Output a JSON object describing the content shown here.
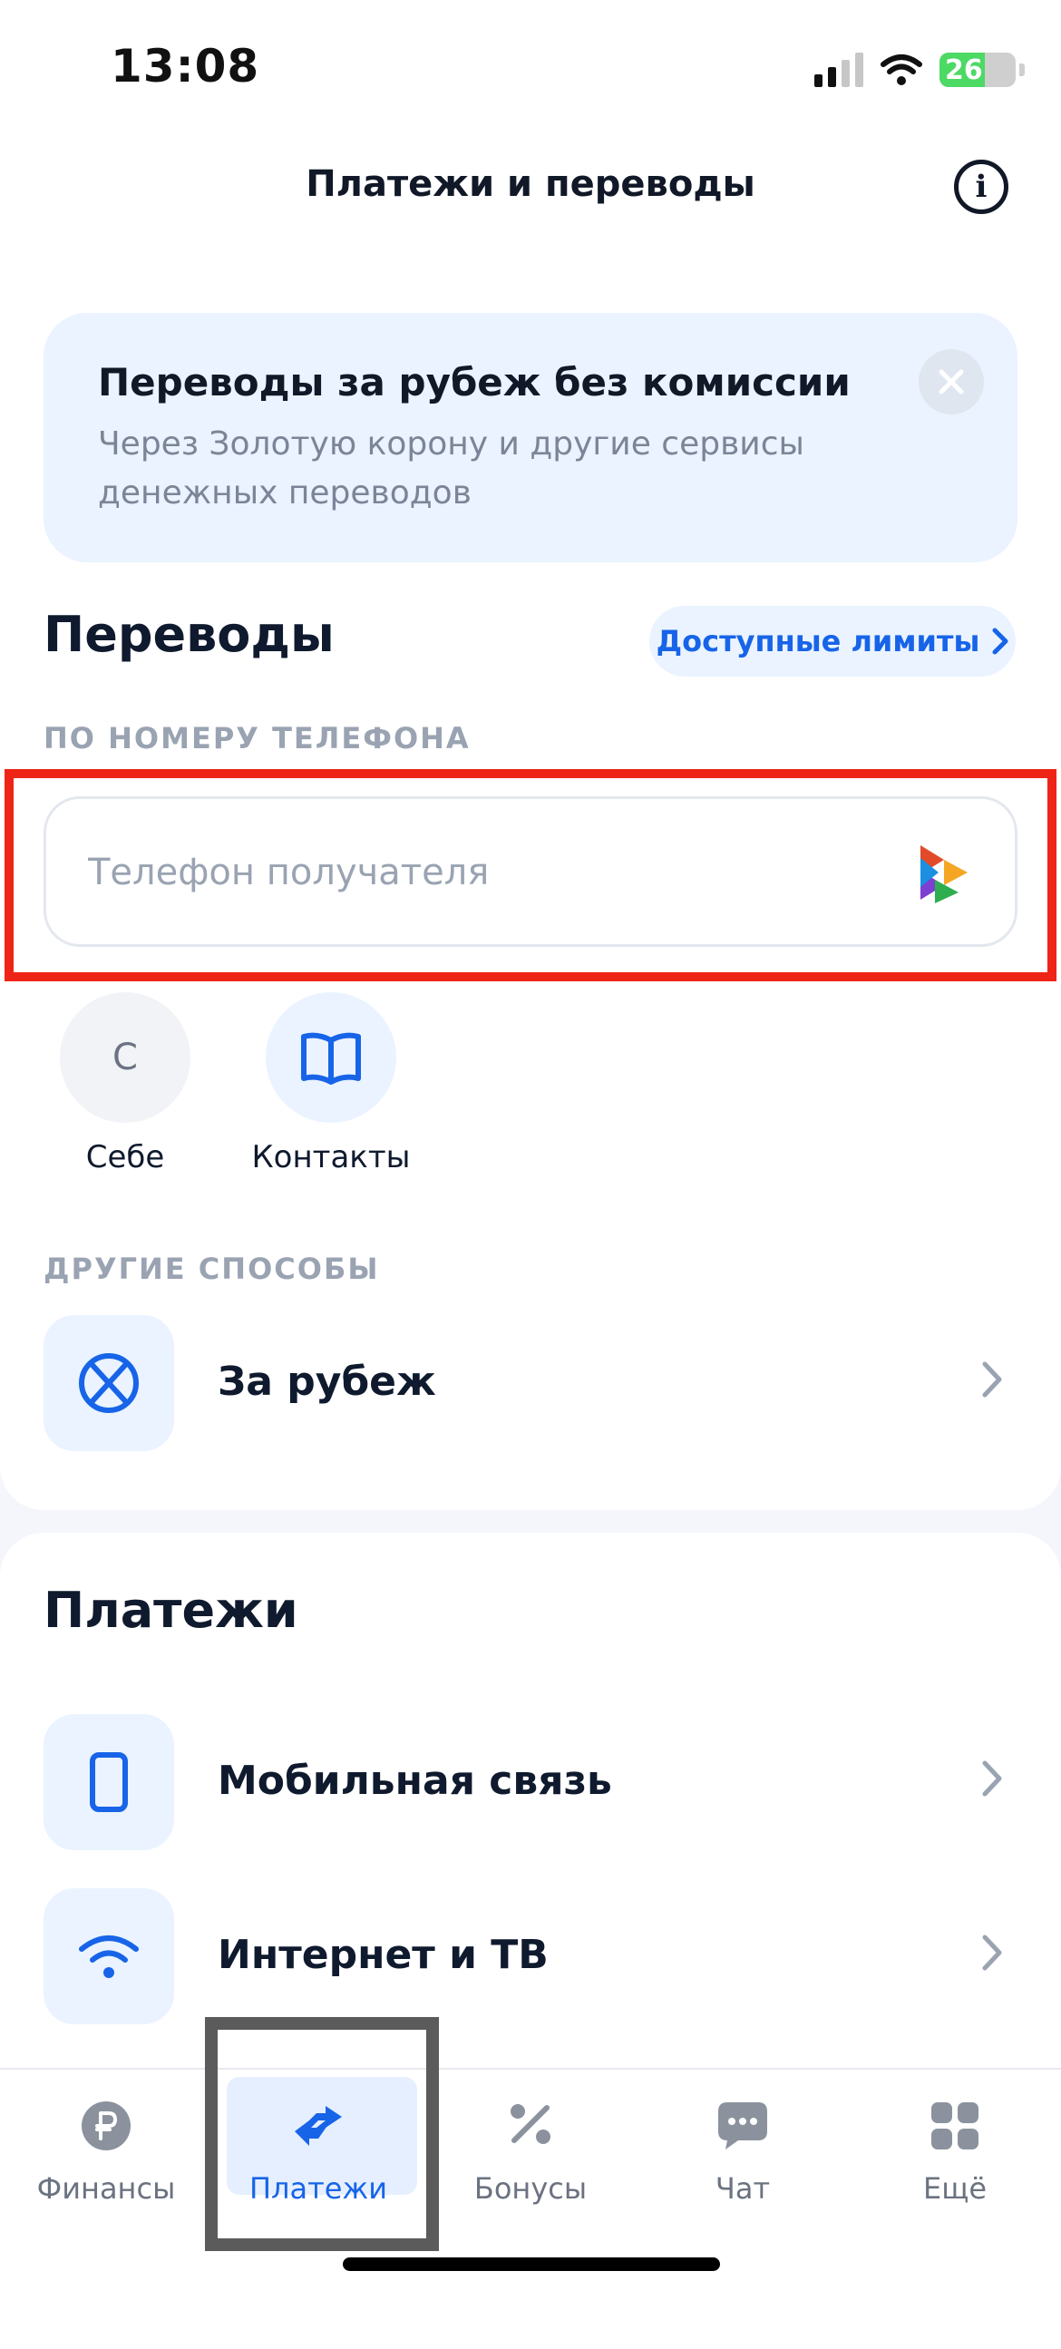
{
  "status_bar": {
    "time": "13:08",
    "battery": "26"
  },
  "header": {
    "title": "Платежи и переводы"
  },
  "promo": {
    "title": "Переводы за рубеж без комиссии",
    "description": "Через Золотую корону и другие сервисы денежных переводов"
  },
  "transfers": {
    "title": "Переводы",
    "limits_label": "Доступные лимиты",
    "by_phone_label": "ПО НОМЕРУ ТЕЛЕФОНА",
    "phone_placeholder": "Телефон получателя",
    "self": {
      "initial": "С",
      "label": "Себе"
    },
    "contacts_label": "Контакты",
    "other_label": "ДРУГИЕ СПОСОБЫ",
    "abroad_label": "За рубеж"
  },
  "payments": {
    "title": "Платежи",
    "items": [
      {
        "label": "Мобильная связь"
      },
      {
        "label": "Интернет и ТВ"
      }
    ]
  },
  "tabs": [
    {
      "label": "Финансы",
      "icon": "ruble-icon"
    },
    {
      "label": "Платежи",
      "icon": "transfer-arrows-icon",
      "active": true
    },
    {
      "label": "Бонусы",
      "icon": "percent-icon"
    },
    {
      "label": "Чат",
      "icon": "chat-icon"
    },
    {
      "label": "Ещё",
      "icon": "grid-icon"
    }
  ],
  "colors": {
    "accent": "#1764e8",
    "highlight_red": "#ee2416",
    "highlight_gray": "#5b5b5b",
    "tile_bg": "#eaf3ff"
  }
}
